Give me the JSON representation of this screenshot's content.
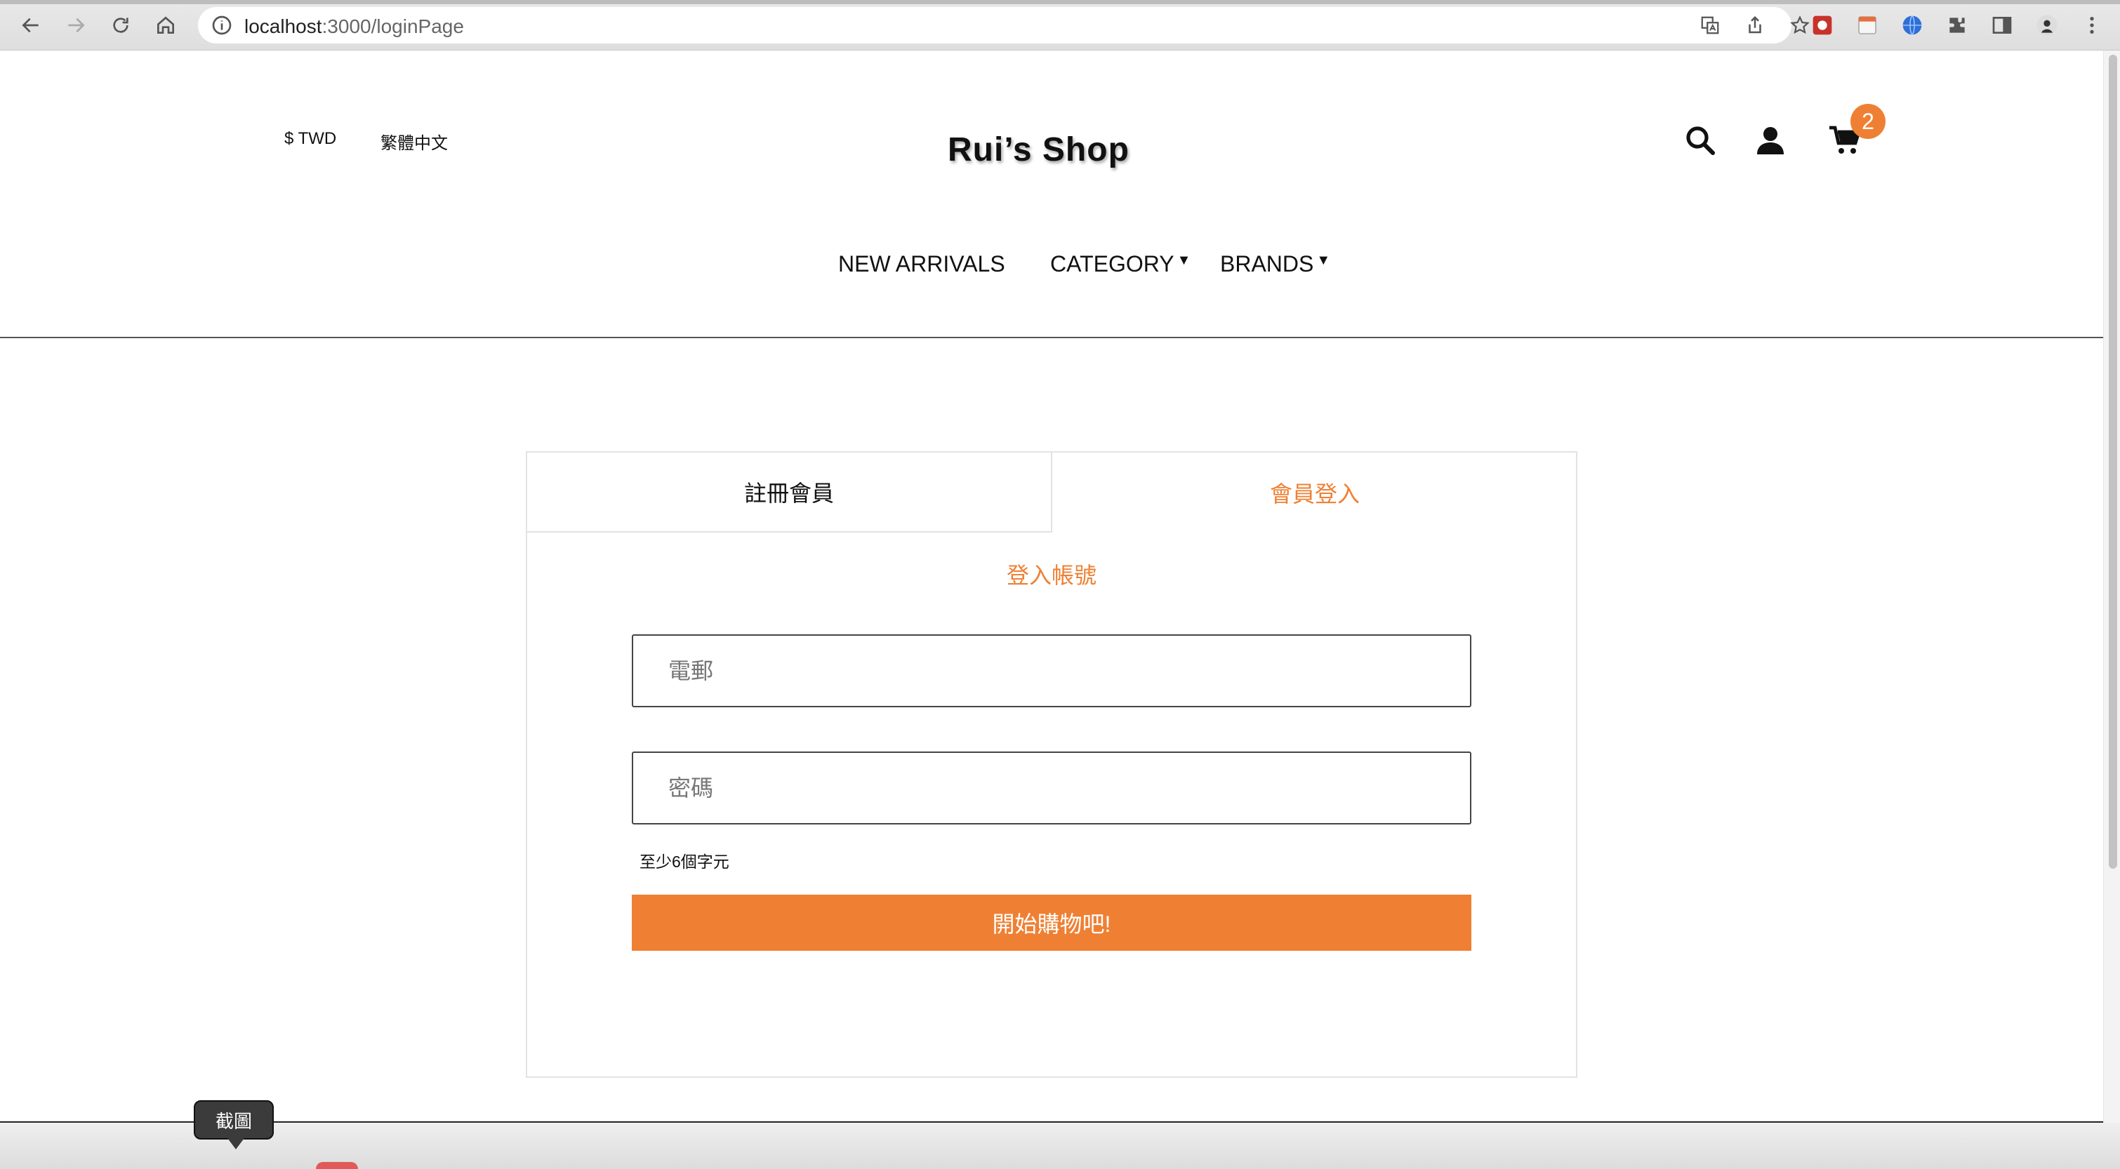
{
  "browser": {
    "url_host": "localhost",
    "url_path": ":3000/loginPage"
  },
  "header": {
    "currency": "$ TWD",
    "language": "繁體中文",
    "brand": "Rui’s Shop",
    "cart_count": "2",
    "icons": [
      "search-icon",
      "user-icon",
      "cart-icon"
    ]
  },
  "menu": {
    "new_arrivals": "NEW ARRIVALS",
    "category": "CATEGORY",
    "brands": "BRANDS",
    "caret": "▼"
  },
  "login": {
    "tab_register": "註冊會員",
    "tab_login": "會員登入",
    "title": "登入帳號",
    "email_placeholder": "電郵",
    "password_placeholder": "密碼",
    "password_hint": "至少6個字元",
    "submit": "開始購物吧!"
  },
  "overlay": {
    "tooltip": "截圖"
  },
  "colors": {
    "accent": "#ef8033"
  }
}
